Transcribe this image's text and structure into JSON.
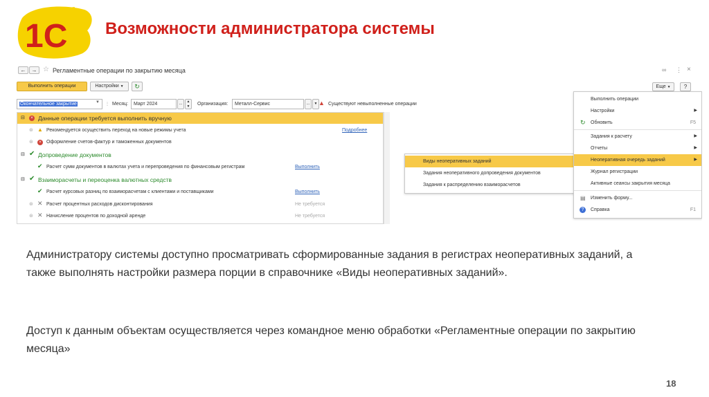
{
  "slide": {
    "logo_text": "1С",
    "title": "Возможности администратора системы",
    "paragraph1": "Администратору системы доступно просматривать сформированные задания в регистрах неоперативных заданий, а также выполнять настройки размера порции в справочнике «Виды неоперативных заданий».",
    "paragraph2": "Доступ к данным объектам осуществляется через командное меню обработки «Регламентные операции по закрытию месяца»",
    "page_number": "18",
    "accent_color": "#d0201b",
    "logo_color": "#f6d200"
  },
  "window": {
    "title": "Регламентные операции по закрытию месяца",
    "toolbar": {
      "run_label": "Выполнить операции",
      "settings_label": "Настройки",
      "refresh_icon": "refresh-icon",
      "more_label": "Еще",
      "help_label": "?"
    },
    "filters": {
      "mode_value": "Окончательное закрытие",
      "month_label": "Месяц:",
      "month_value": "Март 2024",
      "org_label": "Организация:",
      "org_value": "Металл-Сервис",
      "warning_text": "Существуют невыполненные операции"
    },
    "tree": [
      {
        "label": "Данные операции требуется выполнить вручную",
        "status": "error",
        "group": true
      },
      {
        "label": "Рекомендуется осуществить переход на новые режимы учета",
        "status": "warning",
        "action": "Подробнее"
      },
      {
        "label": "Оформление счетов-фактур и таможенных документов",
        "status": "error",
        "action": ""
      },
      {
        "label": "Допроведение документов",
        "status": "ok",
        "group": true
      },
      {
        "label": "Расчет сумм документов в валютах учета и перепроведения по финансовым регистрам",
        "status": "ok",
        "action": "Выполнить"
      },
      {
        "label": "Взаиморасчеты и переоценка валютных средств",
        "status": "ok",
        "group": true
      },
      {
        "label": "Расчет курсовых разниц по взаиморасчетам с клиентами и поставщиками",
        "status": "ok",
        "action": "Выполнить"
      },
      {
        "label": "Расчет процентных расходов дисконтирования",
        "status": "not-needed",
        "action": "Не требуется"
      },
      {
        "label": "Начисление процентов по доходной аренде",
        "status": "not-needed",
        "action": "Не требуется"
      }
    ],
    "menu": [
      {
        "label": "Выполнить операции"
      },
      {
        "label": "Настройки",
        "submenu": true
      },
      {
        "label": "Обновить",
        "key": "F5",
        "icon": "refresh-icon"
      },
      {
        "label": "Задания к расчету",
        "submenu": true
      },
      {
        "label": "Отчеты",
        "submenu": true
      },
      {
        "label": "Неоперативная очередь заданий",
        "submenu": true,
        "highlighted": true
      },
      {
        "label": "Журнал регистрации"
      },
      {
        "label": "Активные сеансы закрытия месяца"
      },
      {
        "label": "Изменить форму...",
        "icon": "form-icon"
      },
      {
        "label": "Справка",
        "key": "F1",
        "icon": "help-icon"
      }
    ],
    "submenu": [
      {
        "label": "Виды неоперативных заданий",
        "highlighted": true
      },
      {
        "label": "Задания неоперативного допроведения документов"
      },
      {
        "label": "Задания к распределению взаиморасчетов"
      }
    ]
  }
}
